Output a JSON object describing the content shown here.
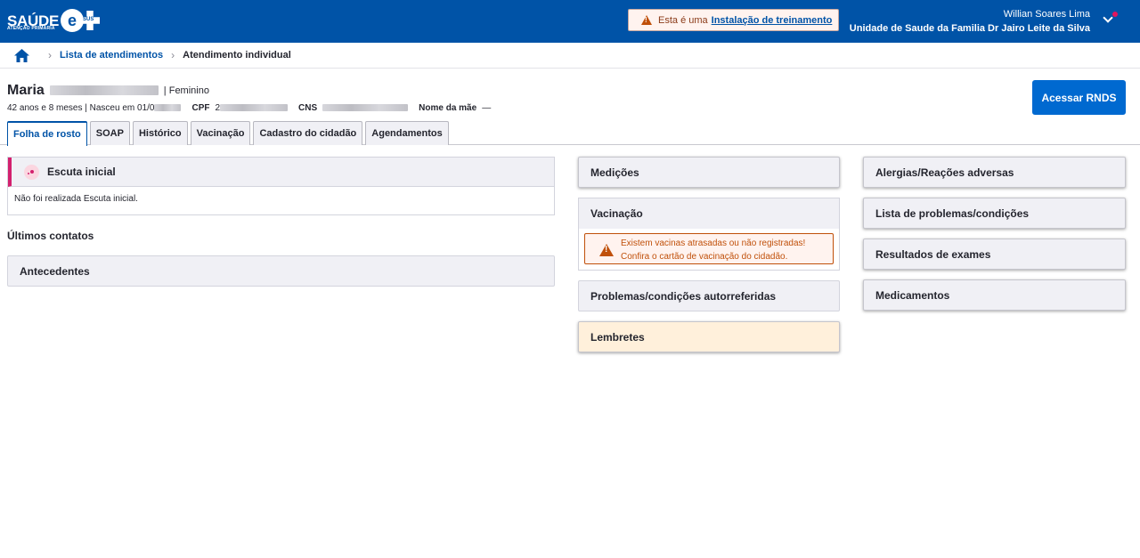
{
  "header": {
    "logo_text": "SAÚDE",
    "logo_e": "e",
    "logo_sus": "SUS",
    "logo_sub": "ATENÇÃO PRIMÁRIA",
    "training_prefix": "Esta é uma",
    "training_link": "Instalação de treinamento",
    "user_name": "Willian Soares Lima",
    "unit_name": "Unidade de Saude da Familia Dr Jairo Leite da Silva",
    "notification_color": "#e0155e"
  },
  "breadcrumb": {
    "link": "Lista de atendimentos",
    "current": "Atendimento individual"
  },
  "patient": {
    "first_name": "Maria",
    "gender_sep": "|",
    "gender": "Feminino",
    "age": "42 anos e 8 meses | Nasceu em 01/0",
    "cpf_label": "CPF",
    "cpf_prefix": "2",
    "cns_label": "CNS",
    "mother_label": "Nome da mãe",
    "mother_value": "—"
  },
  "actions": {
    "rnds_label": "Acessar RNDS"
  },
  "tabs": [
    {
      "label": "Folha de rosto",
      "active": true
    },
    {
      "label": "SOAP"
    },
    {
      "label": "Histórico"
    },
    {
      "label": "Vacinação"
    },
    {
      "label": "Cadastro do cidadão"
    },
    {
      "label": "Agendamentos"
    }
  ],
  "left": {
    "escuta_title": "Escuta inicial",
    "escuta_body": "Não foi realizada Escuta inicial.",
    "ultimos": "Últimos contatos",
    "antecedentes": "Antecedentes"
  },
  "middle": {
    "medicoes": "Medições",
    "vacinacao": "Vacinação",
    "vac_alert_line1": "Existem vacinas atrasadas ou não registradas!",
    "vac_alert_line2": "Confira o cartão de vacinação do cidadão.",
    "problemas_auto": "Problemas/condições autorreferidas",
    "lembretes": "Lembretes"
  },
  "right": {
    "alergias": "Alergias/Reações adversas",
    "problemas": "Lista de problemas/condições",
    "exames": "Resultados de exames",
    "medicamentos": "Medicamentos"
  },
  "colors": {
    "brand": "#0053a7",
    "primary_button": "#0069d0",
    "escuta_accent": "#d3206e",
    "warning": "#c0500a",
    "lembretes_bg": "#fff0db"
  }
}
